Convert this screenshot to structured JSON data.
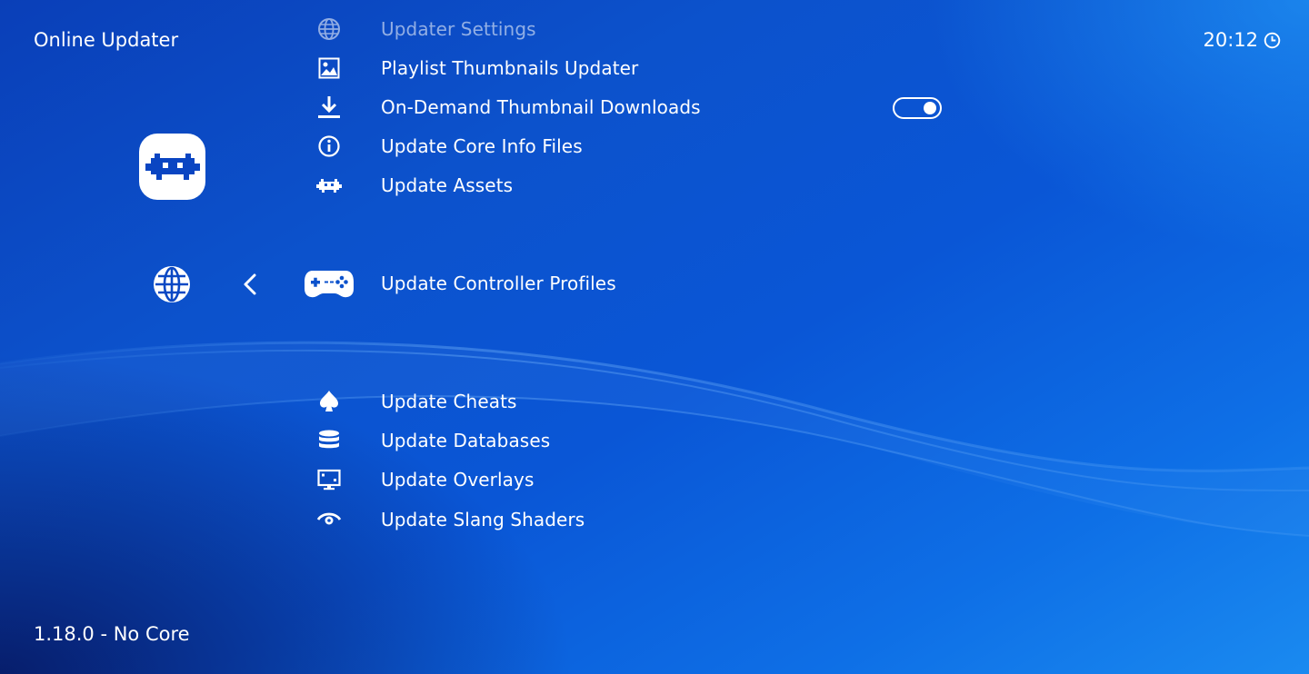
{
  "header": {
    "title": "Online Updater",
    "time": "20:12"
  },
  "footer": {
    "version": "1.18.0 - No Core"
  },
  "menu": {
    "items": [
      {
        "label": "Updater Settings",
        "icon": "globe-icon"
      },
      {
        "label": "Playlist Thumbnails Updater",
        "icon": "image-icon"
      },
      {
        "label": "On-Demand Thumbnail Downloads",
        "icon": "download-icon",
        "toggle": true
      },
      {
        "label": "Update Core Info Files",
        "icon": "info-icon"
      },
      {
        "label": "Update Assets",
        "icon": "retroarch-invader-icon"
      },
      {
        "label": "Update Controller Profiles",
        "icon": "gamepad-icon",
        "selected": true
      },
      {
        "label": "Update Cheats",
        "icon": "spade-icon"
      },
      {
        "label": "Update Databases",
        "icon": "database-icon"
      },
      {
        "label": "Update Overlays",
        "icon": "monitor-icon"
      },
      {
        "label": "Update Slang Shaders",
        "icon": "eye-icon"
      }
    ]
  },
  "colors": {
    "background_top": "#0c52cc",
    "background_bottom_left": "#06145a",
    "background_top_right": "#28aaff",
    "text": "#ffffff"
  }
}
